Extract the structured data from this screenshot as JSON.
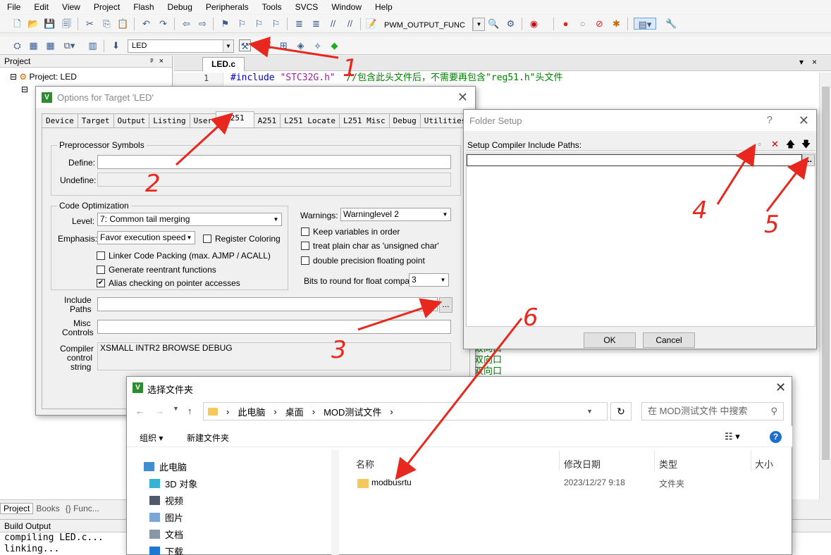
{
  "menu": [
    "File",
    "Edit",
    "View",
    "Project",
    "Flash",
    "Debug",
    "Peripherals",
    "Tools",
    "SVCS",
    "Window",
    "Help"
  ],
  "toolbar": {
    "target_func": "PWM_OUTPUT_FUNC",
    "target_combo": "LED"
  },
  "project_pane": {
    "title": "Project",
    "root": "Project: LED",
    "tabs": [
      "Project",
      "Books",
      "{} Func..."
    ]
  },
  "editor": {
    "tab": "LED.c",
    "line1_num": "1",
    "line1_kw": "#include",
    "line1_str": "\"STC32G.h\"",
    "line1_cmt": "//包含此头文件后，不需要再包含\"reg51.h\"头文件",
    "side_text": [
      "双向口",
      "双向口",
      "双向口"
    ]
  },
  "build_output": {
    "title": "Build Output",
    "lines": [
      "compiling LED.c...",
      "linking..."
    ]
  },
  "options_dialog": {
    "title": "Options for Target 'LED'",
    "tabs": [
      "Device",
      "Target",
      "Output",
      "Listing",
      "User",
      "C251",
      "A251",
      "L251 Locate",
      "L251 Misc",
      "Debug",
      "Utilities"
    ],
    "preproc_group": "Preprocessor Symbols",
    "define_label": "Define:",
    "undefine_label": "Undefine:",
    "codeopt_group": "Code Optimization",
    "level_label": "Level:",
    "level_value": "7: Common tail merging",
    "emphasis_label": "Emphasis:",
    "emphasis_value": "Favor execution speed",
    "register_coloring": "Register Coloring",
    "linker_packing": "Linker Code Packing (max. AJMP / ACALL)",
    "reentrant": "Generate reentrant functions",
    "alias_checking": "Alias checking on pointer accesses",
    "warnings_label": "Warnings:",
    "warnings_value": "Warninglevel 2",
    "keep_vars": "Keep variables in order",
    "plain_char": "treat plain char as 'unsigned char'",
    "double_prec": "double precision floating point",
    "bits_round_label": "Bits to round for float compare:",
    "bits_round_value": "3",
    "include_label_1": "Include",
    "include_label_2": "Paths",
    "misc_label_1": "Misc",
    "misc_label_2": "Controls",
    "compiler_label_1": "Compiler",
    "compiler_label_2": "control",
    "compiler_label_3": "string",
    "compiler_string": "XSMALL INTR2 BROWSE DEBUG",
    "browse_label": "..."
  },
  "folder_dialog": {
    "title": "Folder Setup",
    "help": "?",
    "section_label": "Setup Compiler Include Paths:",
    "ok": "OK",
    "cancel": "Cancel",
    "browse_label": "..."
  },
  "explorer": {
    "title": "选择文件夹",
    "breadcrumb": [
      "此电脑",
      "桌面",
      "MOD测试文件"
    ],
    "search_placeholder": "在 MOD测试文件 中搜索",
    "organize": "组织 ▾",
    "new_folder": "新建文件夹",
    "nav": [
      "此电脑",
      "3D 对象",
      "视频",
      "图片",
      "文档",
      "下载"
    ],
    "columns": [
      "名称",
      "修改日期",
      "类型",
      "大小"
    ],
    "files": [
      {
        "name": "modbusrtu",
        "date": "2023/12/27 9:18",
        "type": "文件夹"
      }
    ]
  },
  "annotations": [
    "1",
    "2",
    "3",
    "4",
    "5",
    "6"
  ],
  "colors": {
    "arrow": "#e8281e",
    "folder": "#f4c85b",
    "keil_green": "#2d8c2d"
  }
}
